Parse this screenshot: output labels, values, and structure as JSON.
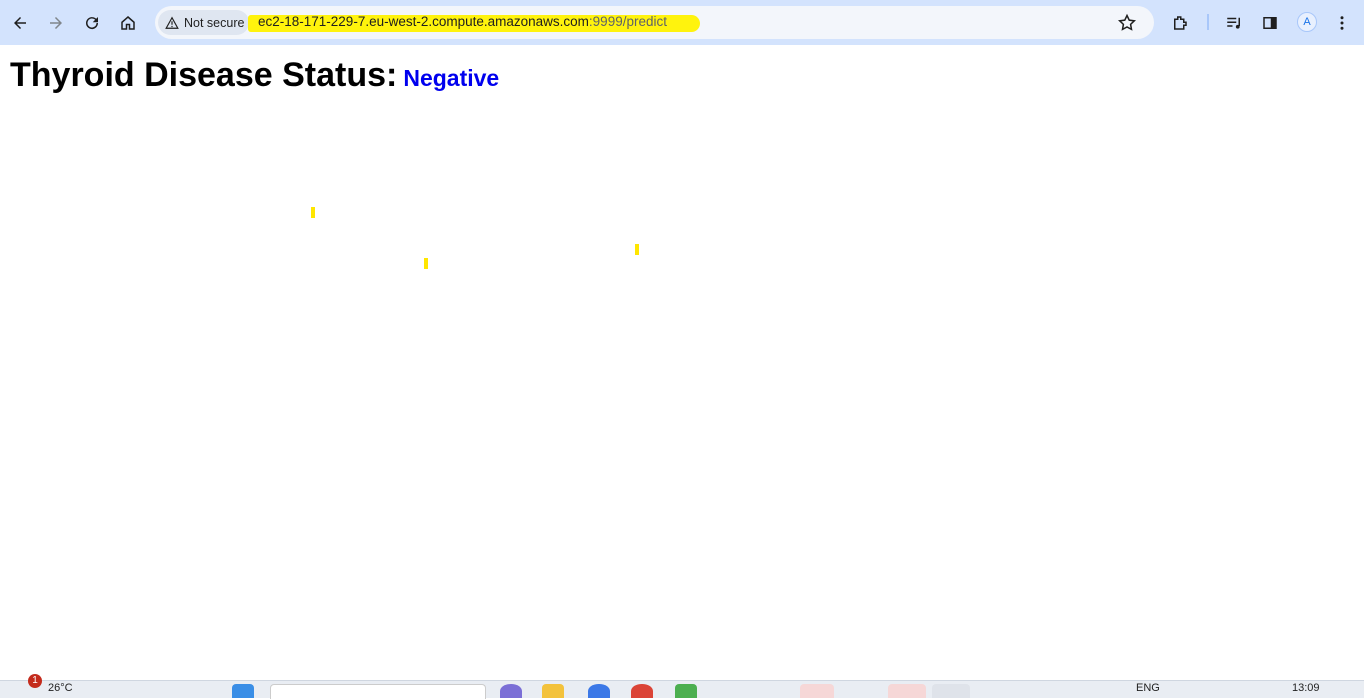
{
  "browser": {
    "security_label": "Not secure",
    "url_host": "ec2-18-171-229-7.eu-west-2.compute.amazonaws.com",
    "url_rest": ":9999/predict",
    "highlight_color": "#fff200",
    "toolbar_color": "#d3e3fd",
    "icons": [
      "back-icon",
      "forward-icon",
      "reload-icon",
      "home-icon",
      "warning-icon",
      "star-icon",
      "extensions-icon",
      "media-icon",
      "side-panel-icon",
      "profile-icon",
      "menu-icon"
    ]
  },
  "page": {
    "title": "Thyroid Disease Status:",
    "status": "Negative",
    "status_color": "#0000ee"
  },
  "taskbar": {
    "weather_temp": "26°C",
    "notification_count": "1",
    "language": "ENG",
    "time": "13:09"
  }
}
